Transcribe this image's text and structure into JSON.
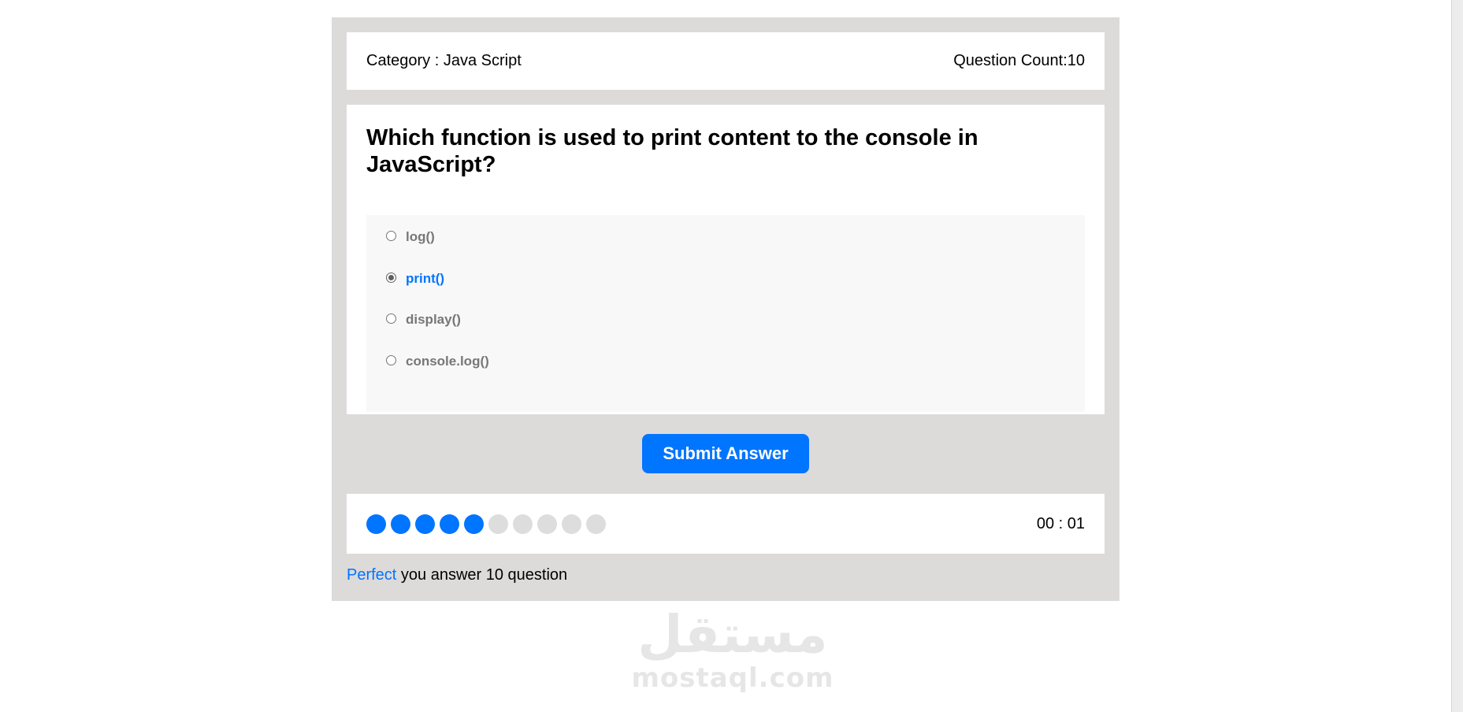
{
  "quiz_info": {
    "category_text": "Category : Java Script",
    "count_text": "Question Count:10"
  },
  "question": {
    "title": "Which function is used to print content to the console in JavaScript?",
    "answers": [
      {
        "label": "log()",
        "selected": false
      },
      {
        "label": "print()",
        "selected": true
      },
      {
        "label": "display()",
        "selected": false
      },
      {
        "label": "console.log()",
        "selected": false
      }
    ]
  },
  "submit_label": "Submit Answer",
  "progress": {
    "answered": 5,
    "total": 10
  },
  "countdown": "00 : 01",
  "results": {
    "rating": "Perfect",
    "message": "you answer 10 question"
  },
  "watermark": {
    "arabic": "مستقل",
    "latin": "mostaql.com"
  },
  "colors": {
    "accent": "#0075ff",
    "frame": "#dddada",
    "bullet_off": "#dddddd"
  }
}
